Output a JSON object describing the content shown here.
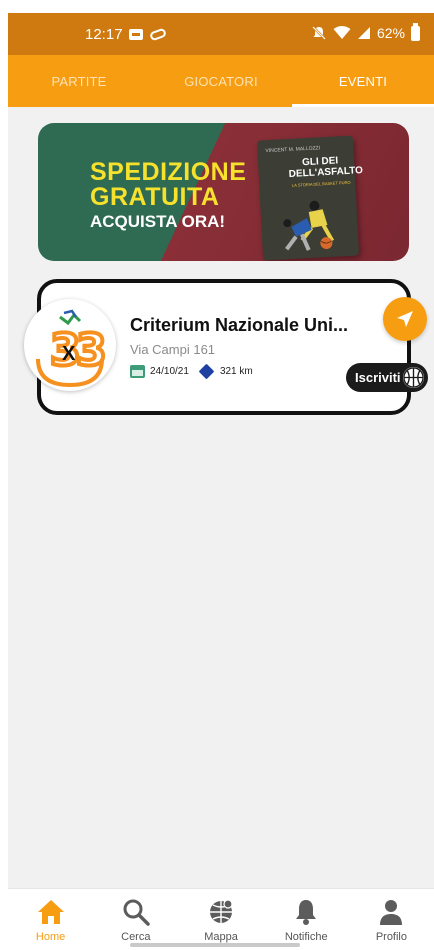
{
  "status_bar": {
    "time": "12:17",
    "battery": "62%"
  },
  "tabs": [
    {
      "label": "PARTITE",
      "active": false
    },
    {
      "label": "GIOCATORI",
      "active": false
    },
    {
      "label": "EVENTI",
      "active": true
    }
  ],
  "banner": {
    "line1": "SPEDIZIONE",
    "line2": "GRATUITA",
    "line3": "ACQUISTA ORA!",
    "book": {
      "author": "VINCENT M. MALLOZZI",
      "title": "GLI DEI DELL'ASFALTO",
      "subtitle": "LA STORIA DEL BASKET PURO"
    }
  },
  "event": {
    "title": "Criterium Nazionale Uni...",
    "address": "Via Campi 161",
    "date": "24/10/21",
    "distance": "321 km",
    "join_label": "Iscriviti",
    "logo_text": "X"
  },
  "bottom_nav": [
    {
      "label": "Home",
      "icon": "home-icon",
      "active": true
    },
    {
      "label": "Cerca",
      "icon": "search-icon",
      "active": false
    },
    {
      "label": "Mappa",
      "icon": "globe-icon",
      "active": false
    },
    {
      "label": "Notifiche",
      "icon": "bell-icon",
      "active": false
    },
    {
      "label": "Profilo",
      "icon": "person-icon",
      "active": false
    }
  ],
  "colors": {
    "accent": "#f79d12",
    "status_bar": "#cf7a10",
    "background": "#f1f1f1"
  }
}
